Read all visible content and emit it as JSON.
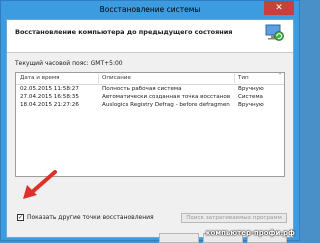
{
  "window": {
    "title": "Восстановление системы",
    "close_glyph": "✕"
  },
  "heading": "Восстановление компьютера до предыдущего состояния",
  "timezone": {
    "label": "Текущий часовой пояс:",
    "value": "GMT+5:00"
  },
  "table": {
    "columns": [
      "Дата и время",
      "Описание",
      "Тип"
    ],
    "rows": [
      {
        "date": "02.05.2015 11:58:27",
        "desc": "Полность рабочая система",
        "type": "Вручную"
      },
      {
        "date": "27.04.2015 16:58:35",
        "desc": "Автоматически созданная точка восстанове...",
        "type": "Система"
      },
      {
        "date": "18.04.2015 21:27:26",
        "desc": "Auslogics Registry Defrag - before defragmentation",
        "type": "Вручную"
      }
    ]
  },
  "checkbox": {
    "label": "Показать другие точки восстановления",
    "checked_glyph": "✓"
  },
  "buttons": {
    "scan": "Поиск затрагиваемых программ",
    "back": "",
    "next": "",
    "cancel": ""
  },
  "watermark": "компьютер-профи.рф",
  "icons": {
    "header": "restore-icon",
    "arrow": "red-arrow"
  },
  "colors": {
    "titlebar": "#3d9be0",
    "close": "#c7403a",
    "arrow": "#e0302a"
  }
}
